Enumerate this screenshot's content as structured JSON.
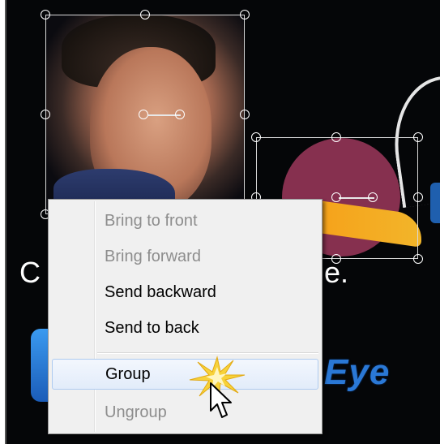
{
  "canvas": {
    "background_text_left": "C",
    "background_text_right": "e.",
    "logo_text": "Eye"
  },
  "context_menu": {
    "items": [
      {
        "label": "Bring to front",
        "enabled": false
      },
      {
        "label": "Bring forward",
        "enabled": false
      },
      {
        "label": "Send backward",
        "enabled": true
      },
      {
        "label": "Send to back",
        "enabled": true
      },
      {
        "label": "Group",
        "enabled": true,
        "hovered": true
      },
      {
        "label": "Ungroup",
        "enabled": false
      }
    ]
  },
  "colors": {
    "canvas_bg": "#050608",
    "logo_circle": "#86304f",
    "logo_ribbon": "#f6a019",
    "menu_hover": "#e2ecfa",
    "highlight_sparkle": "#f7d23a"
  }
}
